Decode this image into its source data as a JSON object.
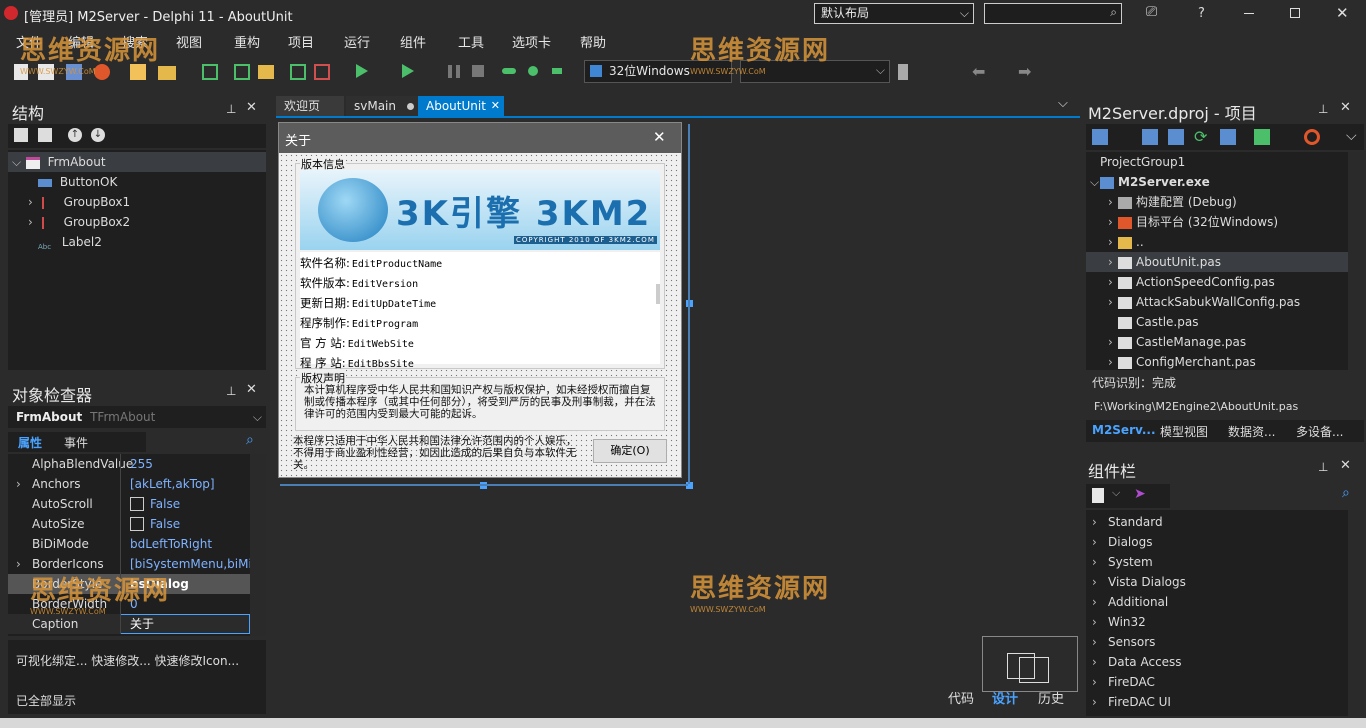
{
  "window": {
    "title": "[管理员] M2Server - Delphi 11 - AboutUnit",
    "layout_select": "默认布局",
    "search_placeholder": "",
    "help_label": "?"
  },
  "menu": [
    "文件",
    "编辑",
    "搜索",
    "视图",
    "重构",
    "项目",
    "运行",
    "组件",
    "工具",
    "选项卡",
    "帮助"
  ],
  "toolbar": {
    "platform": "32位Windows",
    "config": ""
  },
  "tabs": [
    {
      "label": "欢迎页"
    },
    {
      "label": "svMain"
    },
    {
      "label": "AboutUnit",
      "active": true
    }
  ],
  "structure": {
    "title": "结构",
    "items": [
      {
        "label": "FrmAbout",
        "level": 0
      },
      {
        "label": "ButtonOK",
        "level": 1
      },
      {
        "label": "GroupBox1",
        "level": 1
      },
      {
        "label": "GroupBox2",
        "level": 1
      },
      {
        "label": "Label2",
        "level": 1
      }
    ]
  },
  "inspector": {
    "title": "对象检查器",
    "object_name": "FrmAbout",
    "object_type": "TFrmAbout",
    "tab_props": "属性",
    "tab_events": "事件",
    "rows": [
      {
        "name": "AlphaBlendValue",
        "value": "255"
      },
      {
        "name": "Anchors",
        "value": "[akLeft,akTop]"
      },
      {
        "name": "AutoScroll",
        "value": "False"
      },
      {
        "name": "AutoSize",
        "value": "False"
      },
      {
        "name": "BiDiMode",
        "value": "bdLeftToRight"
      },
      {
        "name": "BorderIcons",
        "value": "[biSystemMenu,biMini"
      },
      {
        "name": "BorderStyle",
        "value": "bsDialog"
      },
      {
        "name": "BorderWidth",
        "value": "0"
      },
      {
        "name": "Caption",
        "value": "关于"
      }
    ],
    "footer_links": "可视化绑定... 快速修改... 快速修改Icon...",
    "footer_status": "已全部显示"
  },
  "form": {
    "caption": "关于",
    "group1_title": "版本信息",
    "banner_text": "3K引擎 3KM2",
    "banner_copyright": "COPYRIGHT 2010 OF 3KM2.COM",
    "fields": [
      {
        "label": "软件名称:",
        "value": "EditProductName"
      },
      {
        "label": "软件版本:",
        "value": "EditVersion"
      },
      {
        "label": "更新日期:",
        "value": "EditUpDateTime"
      },
      {
        "label": "程序制作:",
        "value": "EditProgram"
      },
      {
        "label": "官 方 站:",
        "value": "EditWebSite"
      },
      {
        "label": "程 序 站:",
        "value": "EditBbsSite"
      }
    ],
    "group2_title": "版权声明",
    "copyright_text": "本计算机程序受中华人民共和国知识产权与版权保护，如未经授权而擅自复制或传播本程序（或其中任何部分），将受到严厉的民事及刑事制裁，并在法律许可的范围内受到最大可能的起诉。",
    "note_text": "本程序只适用于中华人民共和国法律允许范围内的个人娱乐，不得用于商业盈利性经营，如因此造成的后果自负与本软件无关。",
    "ok_button": "确定(O)"
  },
  "editor_bottom": {
    "code": "代码",
    "design": "设计",
    "history": "历史"
  },
  "project": {
    "title": "M2Server.dproj - 项目",
    "items": [
      {
        "label": "ProjectGroup1"
      },
      {
        "label": "M2Server.exe"
      },
      {
        "label": "构建配置 (Debug)"
      },
      {
        "label": "目标平台 (32位Windows)"
      },
      {
        "label": ".."
      },
      {
        "label": "AboutUnit.pas"
      },
      {
        "label": "ActionSpeedConfig.pas"
      },
      {
        "label": "AttackSabukWallConfig.pas"
      },
      {
        "label": "Castle.pas"
      },
      {
        "label": "CastleManage.pas"
      },
      {
        "label": "ConfigMerchant.pas"
      }
    ],
    "code_status": "代码识别：完成",
    "path": "F:\\Working\\M2Engine2\\AboutUnit.pas",
    "tabs": [
      "M2Serv...",
      "模型视图",
      "数据资...",
      "多设备..."
    ]
  },
  "palette": {
    "title": "组件栏",
    "items": [
      "Standard",
      "Dialogs",
      "System",
      "Vista Dialogs",
      "Additional",
      "Win32",
      "Sensors",
      "Data Access",
      "FireDAC",
      "FireDAC UI"
    ]
  },
  "watermark": {
    "text": "思维资源网",
    "sub": "WWW.SWZYW.CoM"
  },
  "colors": {
    "accent": "#007acc",
    "bg": "#2b2b2b",
    "panel": "#1f1f1f",
    "tab_active": "#007acc"
  }
}
